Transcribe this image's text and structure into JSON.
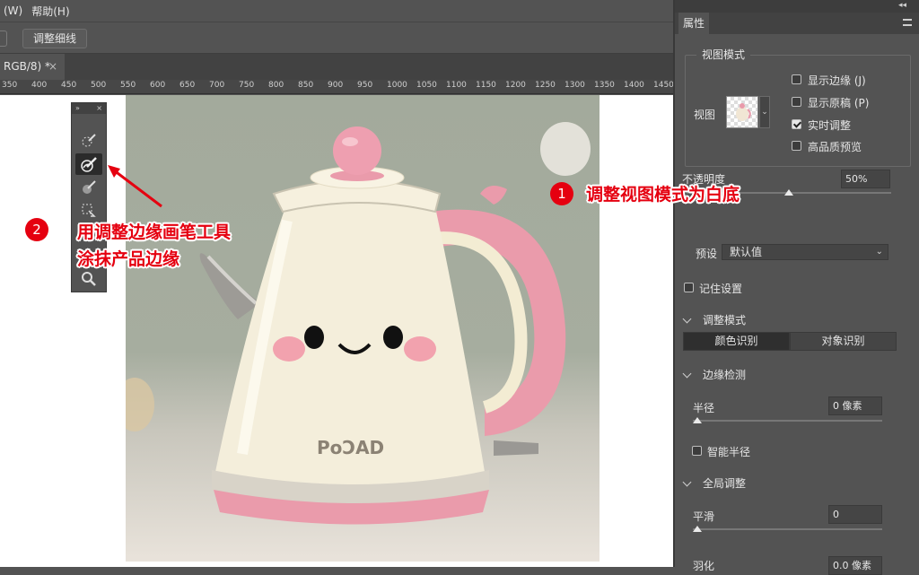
{
  "menubar": {
    "items": [
      "(W)",
      "帮助(H)"
    ]
  },
  "options_bar": {
    "refine_edge_label": "调整细线"
  },
  "document_tab": {
    "title": "RGB/8) *",
    "close": "×"
  },
  "ruler": {
    "ticks": [
      "350",
      "400",
      "450",
      "500",
      "550",
      "600",
      "650",
      "700",
      "750",
      "800",
      "850",
      "900",
      "950",
      "1000",
      "1050",
      "1100",
      "1150",
      "1200",
      "1250",
      "1300",
      "1350",
      "1400",
      "1450"
    ]
  },
  "tool_panel": {
    "header_left": "»",
    "header_right": "×",
    "tools": [
      "quick-selection",
      "refine-edge-brush",
      "brush",
      "object-selection",
      "lasso",
      "hand",
      "zoom"
    ]
  },
  "annotations": {
    "one": {
      "number": "1",
      "text": "调整视图模式为白底"
    },
    "two": {
      "number": "2",
      "line1": "用调整边缘画笔工具",
      "line2": "涂抹产品边缘"
    }
  },
  "product": {
    "brand": "PoƆAD"
  },
  "panel": {
    "tab": "属性",
    "view_mode": {
      "group_title": "视图模式",
      "view_label": "视图",
      "show_edge": "显示边缘 (J)",
      "show_original": "显示原稿 (P)",
      "realtime": "实时调整",
      "hq_preview": "高品质预览",
      "realtime_checked": true
    },
    "opacity": {
      "label": "不透明度",
      "value": "50%",
      "level": 0.5
    },
    "preset": {
      "label": "预设",
      "value": "默认值"
    },
    "remember": "记住设置",
    "refine_mode": {
      "title": "调整模式",
      "color": "颜色识别",
      "object": "对象识别"
    },
    "edge_detection": {
      "title": "边缘检测",
      "radius_label": "半径",
      "radius_value": "0 像素",
      "smart_radius": "智能半径"
    },
    "global": {
      "title": "全局调整",
      "smooth_label": "平滑",
      "smooth_value": "0",
      "feather_label": "羽化",
      "feather_value": "0.0 像素"
    }
  },
  "colors": {
    "accent_red": "#e50010",
    "panel_bg": "#535353",
    "kettle_pink": "#e99aaa",
    "kettle_cream": "#f3ecd3"
  }
}
